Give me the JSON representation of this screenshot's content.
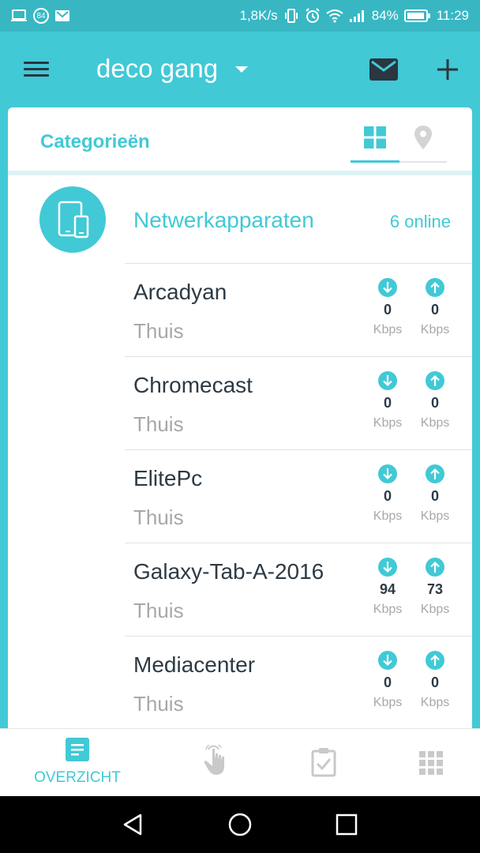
{
  "status_bar": {
    "left_icons": [
      "screen-icon",
      "notification-84-badge",
      "gmail-icon"
    ],
    "badge": "84",
    "speed": "1,8K/s",
    "battery": "84%",
    "time": "11:29"
  },
  "app_bar": {
    "title": "deco gang"
  },
  "card": {
    "title": "Categorieën",
    "tabs": [
      "grid-icon",
      "location-pin-icon"
    ]
  },
  "section": {
    "title": "Netwerkapparaten",
    "count": "6 online"
  },
  "devices": [
    {
      "name": "Arcadyan",
      "location": "Thuis",
      "down": "0",
      "up": "0",
      "unit": "Kbps"
    },
    {
      "name": "Chromecast",
      "location": "Thuis",
      "down": "0",
      "up": "0",
      "unit": "Kbps"
    },
    {
      "name": "ElitePc",
      "location": "Thuis",
      "down": "0",
      "up": "0",
      "unit": "Kbps"
    },
    {
      "name": "Galaxy-Tab-A-2016",
      "location": "Thuis",
      "down": "94",
      "up": "73",
      "unit": "Kbps"
    },
    {
      "name": "Mediacenter",
      "location": "Thuis",
      "down": "0",
      "up": "0",
      "unit": "Kbps"
    }
  ],
  "bottom_nav": {
    "items": [
      {
        "icon": "overview-list-icon",
        "label": "OVERZICHT",
        "active": true
      },
      {
        "icon": "touch-hand-icon"
      },
      {
        "icon": "clipboard-check-icon"
      },
      {
        "icon": "apps-grid-icon"
      }
    ]
  },
  "colors": {
    "accent": "#41c9d6",
    "status_bar": "#38b7c3",
    "text_dark": "#2d3a44",
    "text_muted": "#a8a8a8",
    "icon_inactive": "#c9c9c9"
  }
}
